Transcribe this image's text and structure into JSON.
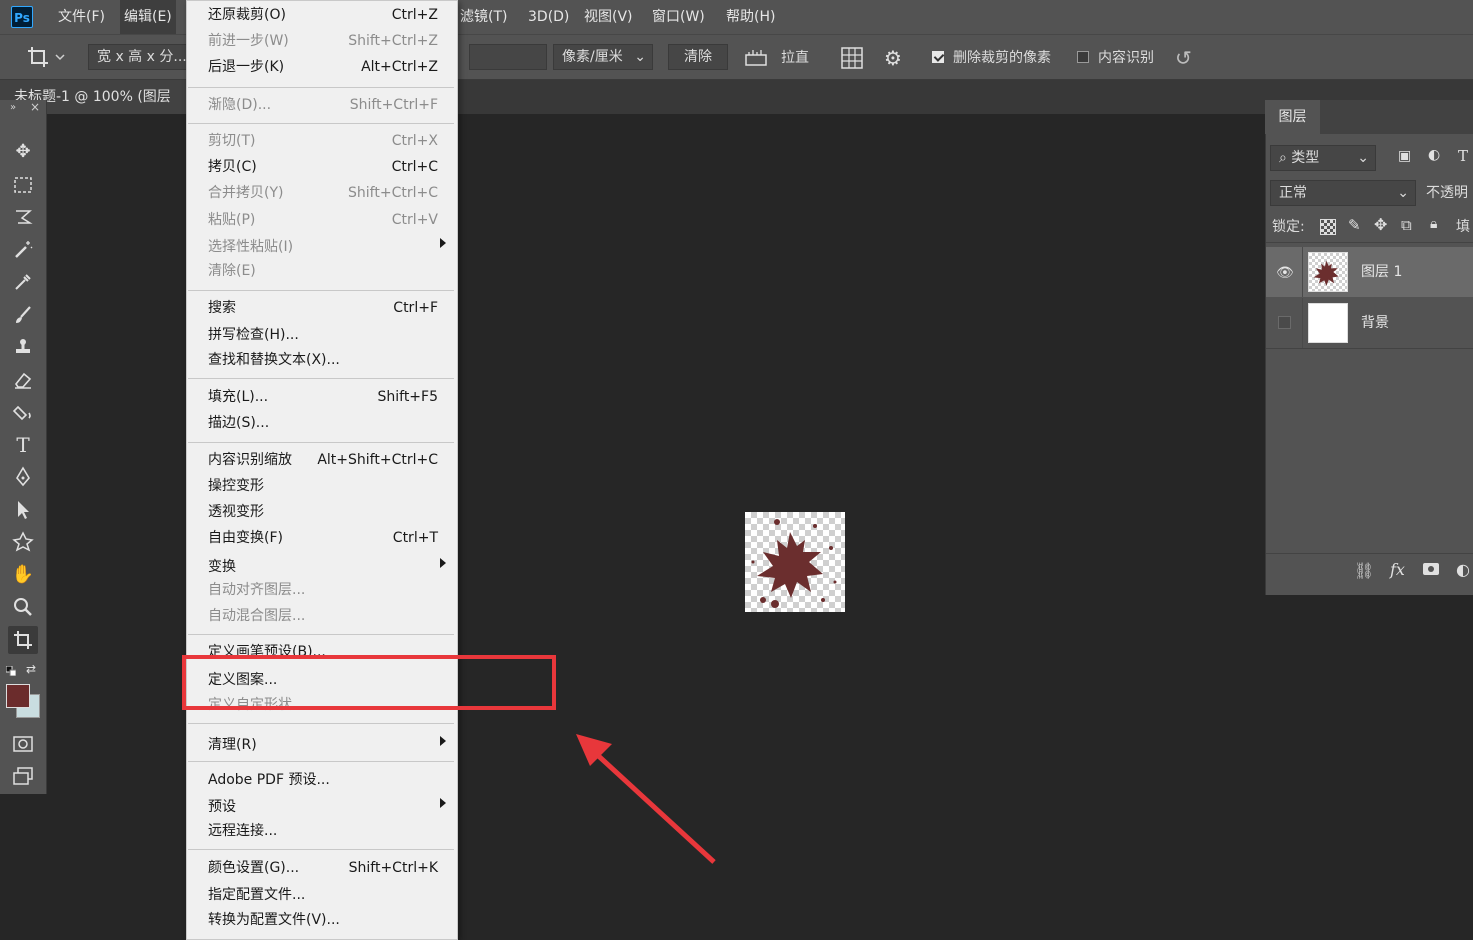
{
  "menubar": {
    "items": [
      "文件(F)",
      "编辑(E)",
      "滤镜(T)",
      "3D(D)",
      "视图(V)",
      "窗口(W)",
      "帮助(H)"
    ]
  },
  "optbar": {
    "ratio": "宽 x 高 x 分...",
    "unit": "像素/厘米",
    "clear": "清除",
    "straighten": "拉直",
    "delete_cropped": "删除裁剪的像素",
    "content_aware": "内容识别"
  },
  "doc_tab": "未标题-1 @ 100% (图层",
  "layers": {
    "tab": "图层",
    "filter_kind": "类型",
    "blend_mode": "正常",
    "opacity_label": "不透明",
    "lock_label": "锁定:",
    "fill_label": "填",
    "rows": [
      {
        "name": "图层 1"
      },
      {
        "name": "背景"
      }
    ],
    "fx_label": "fx"
  },
  "edit_menu": {
    "items": [
      {
        "label": "还原裁剪(O)",
        "shortcut": "Ctrl+Z"
      },
      {
        "label": "前进一步(W)",
        "shortcut": "Shift+Ctrl+Z"
      },
      {
        "label": "后退一步(K)",
        "shortcut": "Alt+Ctrl+Z"
      },
      {
        "label": "渐隐(D)...",
        "shortcut": "Shift+Ctrl+F"
      },
      {
        "label": "剪切(T)",
        "shortcut": "Ctrl+X"
      },
      {
        "label": "拷贝(C)",
        "shortcut": "Ctrl+C"
      },
      {
        "label": "合并拷贝(Y)",
        "shortcut": "Shift+Ctrl+C"
      },
      {
        "label": "粘贴(P)",
        "shortcut": "Ctrl+V"
      },
      {
        "label": "选择性粘贴(I)",
        "shortcut": ""
      },
      {
        "label": "清除(E)",
        "shortcut": ""
      },
      {
        "label": "搜索",
        "shortcut": "Ctrl+F"
      },
      {
        "label": "拼写检查(H)...",
        "shortcut": ""
      },
      {
        "label": "查找和替换文本(X)...",
        "shortcut": ""
      },
      {
        "label": "填充(L)...",
        "shortcut": "Shift+F5"
      },
      {
        "label": "描边(S)...",
        "shortcut": ""
      },
      {
        "label": "内容识别缩放",
        "shortcut": "Alt+Shift+Ctrl+C"
      },
      {
        "label": "操控变形",
        "shortcut": ""
      },
      {
        "label": "透视变形",
        "shortcut": ""
      },
      {
        "label": "自由变换(F)",
        "shortcut": "Ctrl+T"
      },
      {
        "label": "变换",
        "shortcut": ""
      },
      {
        "label": "自动对齐图层...",
        "shortcut": ""
      },
      {
        "label": "自动混合图层...",
        "shortcut": ""
      },
      {
        "label": "定义画笔预设(B)...",
        "shortcut": ""
      },
      {
        "label": "定义图案...",
        "shortcut": ""
      },
      {
        "label": "定义自定形状...",
        "shortcut": ""
      },
      {
        "label": "清理(R)",
        "shortcut": ""
      },
      {
        "label": "Adobe PDF 预设...",
        "shortcut": ""
      },
      {
        "label": "预设",
        "shortcut": ""
      },
      {
        "label": "远程连接...",
        "shortcut": ""
      },
      {
        "label": "颜色设置(G)...",
        "shortcut": "Shift+Ctrl+K"
      },
      {
        "label": "指定配置文件...",
        "shortcut": ""
      },
      {
        "label": "转换为配置文件(V)...",
        "shortcut": ""
      }
    ]
  },
  "colors": {
    "foreground": "#6b2c2c",
    "background": "#c9dde0",
    "splatter": "#6b2e2e",
    "highlight": "#e8373b"
  }
}
